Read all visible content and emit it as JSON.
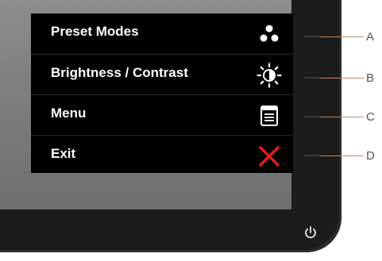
{
  "osd_menu": {
    "items": [
      {
        "label": "Preset Modes",
        "icon": "preset-modes-icon",
        "button": "A"
      },
      {
        "label": "Brightness / Contrast",
        "icon": "brightness-contrast-icon",
        "button": "B"
      },
      {
        "label": "Menu",
        "icon": "menu-icon",
        "button": "C"
      },
      {
        "label": "Exit",
        "icon": "exit-icon",
        "button": "D"
      }
    ]
  },
  "callouts": [
    "A",
    "B",
    "C",
    "D"
  ],
  "power_button": {
    "icon": "power-icon"
  },
  "colors": {
    "osd_background": "#000000",
    "osd_text": "#ffffff",
    "exit_icon": "#e0201c",
    "bezel": "#1c1c1c",
    "callout_line": "#c08a6a"
  }
}
